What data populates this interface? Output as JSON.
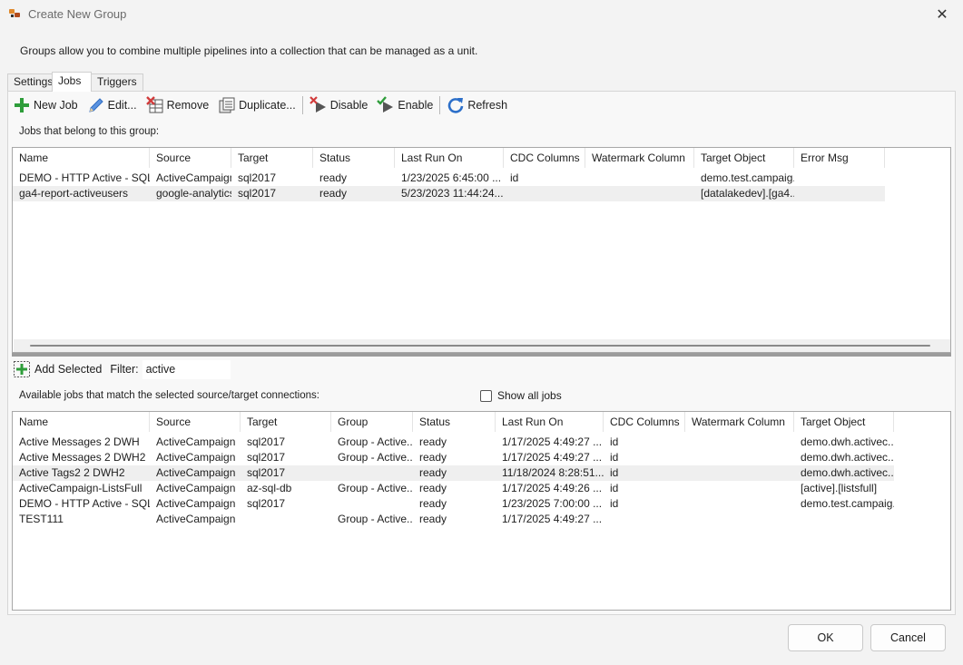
{
  "window": {
    "title": "Create New Group",
    "close_glyph": "✕"
  },
  "description": "Groups allow you to combine multiple pipelines into a collection that can be managed as a unit.",
  "tabs": [
    {
      "label": "Settings"
    },
    {
      "label": "Jobs",
      "active": true
    },
    {
      "label": "Triggers"
    }
  ],
  "toolbar": {
    "new_job": "New Job",
    "edit": "Edit...",
    "remove": "Remove",
    "duplicate": "Duplicate...",
    "disable": "Disable",
    "enable": "Enable",
    "refresh": "Refresh"
  },
  "group_jobs": {
    "label": "Jobs that belong to this group:",
    "columns": [
      "Name",
      "Source",
      "Target",
      "Status",
      "Last Run On",
      "CDC Columns",
      "Watermark Column",
      "Target Object",
      "Error Msg"
    ],
    "rows": [
      [
        "DEMO - HTTP Active - SQL",
        "ActiveCampaign",
        "sql2017",
        "ready",
        "1/23/2025 6:45:00 ...",
        "id",
        "",
        "demo.test.campaig...",
        ""
      ],
      [
        "ga4-report-activeusers",
        "google-analytics",
        "sql2017",
        "ready",
        "5/23/2023 11:44:24...",
        "",
        "",
        "[datalakedev].[ga4...",
        ""
      ]
    ]
  },
  "add_selected": "Add Selected",
  "filter": {
    "label": "Filter:",
    "value": "active"
  },
  "available_jobs": {
    "label": "Available jobs that match the selected source/target connections:",
    "show_all": "Show all jobs",
    "columns": [
      "Name",
      "Source",
      "Target",
      "Group",
      "Status",
      "Last Run On",
      "CDC Columns",
      "Watermark Column",
      "Target Object"
    ],
    "rows": [
      [
        "Active Messages 2 DWH",
        "ActiveCampaign",
        "sql2017",
        "Group - Active...",
        "ready",
        "1/17/2025 4:49:27 ...",
        "id",
        "",
        "demo.dwh.activec..."
      ],
      [
        "Active Messages 2 DWH2",
        "ActiveCampaign",
        "sql2017",
        "Group - Active...",
        "ready",
        "1/17/2025 4:49:27 ...",
        "id",
        "",
        "demo.dwh.activec..."
      ],
      [
        "Active Tags2 2 DWH2",
        "ActiveCampaign",
        "sql2017",
        "",
        "ready",
        "11/18/2024 8:28:51...",
        "id",
        "",
        "demo.dwh.activec..."
      ],
      [
        "ActiveCampaign-ListsFull",
        "ActiveCampaign",
        "az-sql-db",
        "Group - Active...",
        "ready",
        "1/17/2025 4:49:26 ...",
        "id",
        "",
        "[active].[listsfull]"
      ],
      [
        "DEMO - HTTP Active - SQL",
        "ActiveCampaign",
        "sql2017",
        "",
        "ready",
        "1/23/2025 7:00:00 ...",
        "id",
        "",
        "demo.test.campaig..."
      ],
      [
        "TEST111",
        "ActiveCampaign",
        "",
        "Group - Active...",
        "ready",
        "1/17/2025 4:49:27 ...",
        "",
        "",
        ""
      ]
    ]
  },
  "buttons": {
    "ok": "OK",
    "cancel": "Cancel"
  },
  "colors": {
    "green_plus": "#2e9d3a",
    "pencil": "#3d7fd6",
    "remove_red": "#d23c3c",
    "refresh_blue": "#2c6fc9"
  }
}
